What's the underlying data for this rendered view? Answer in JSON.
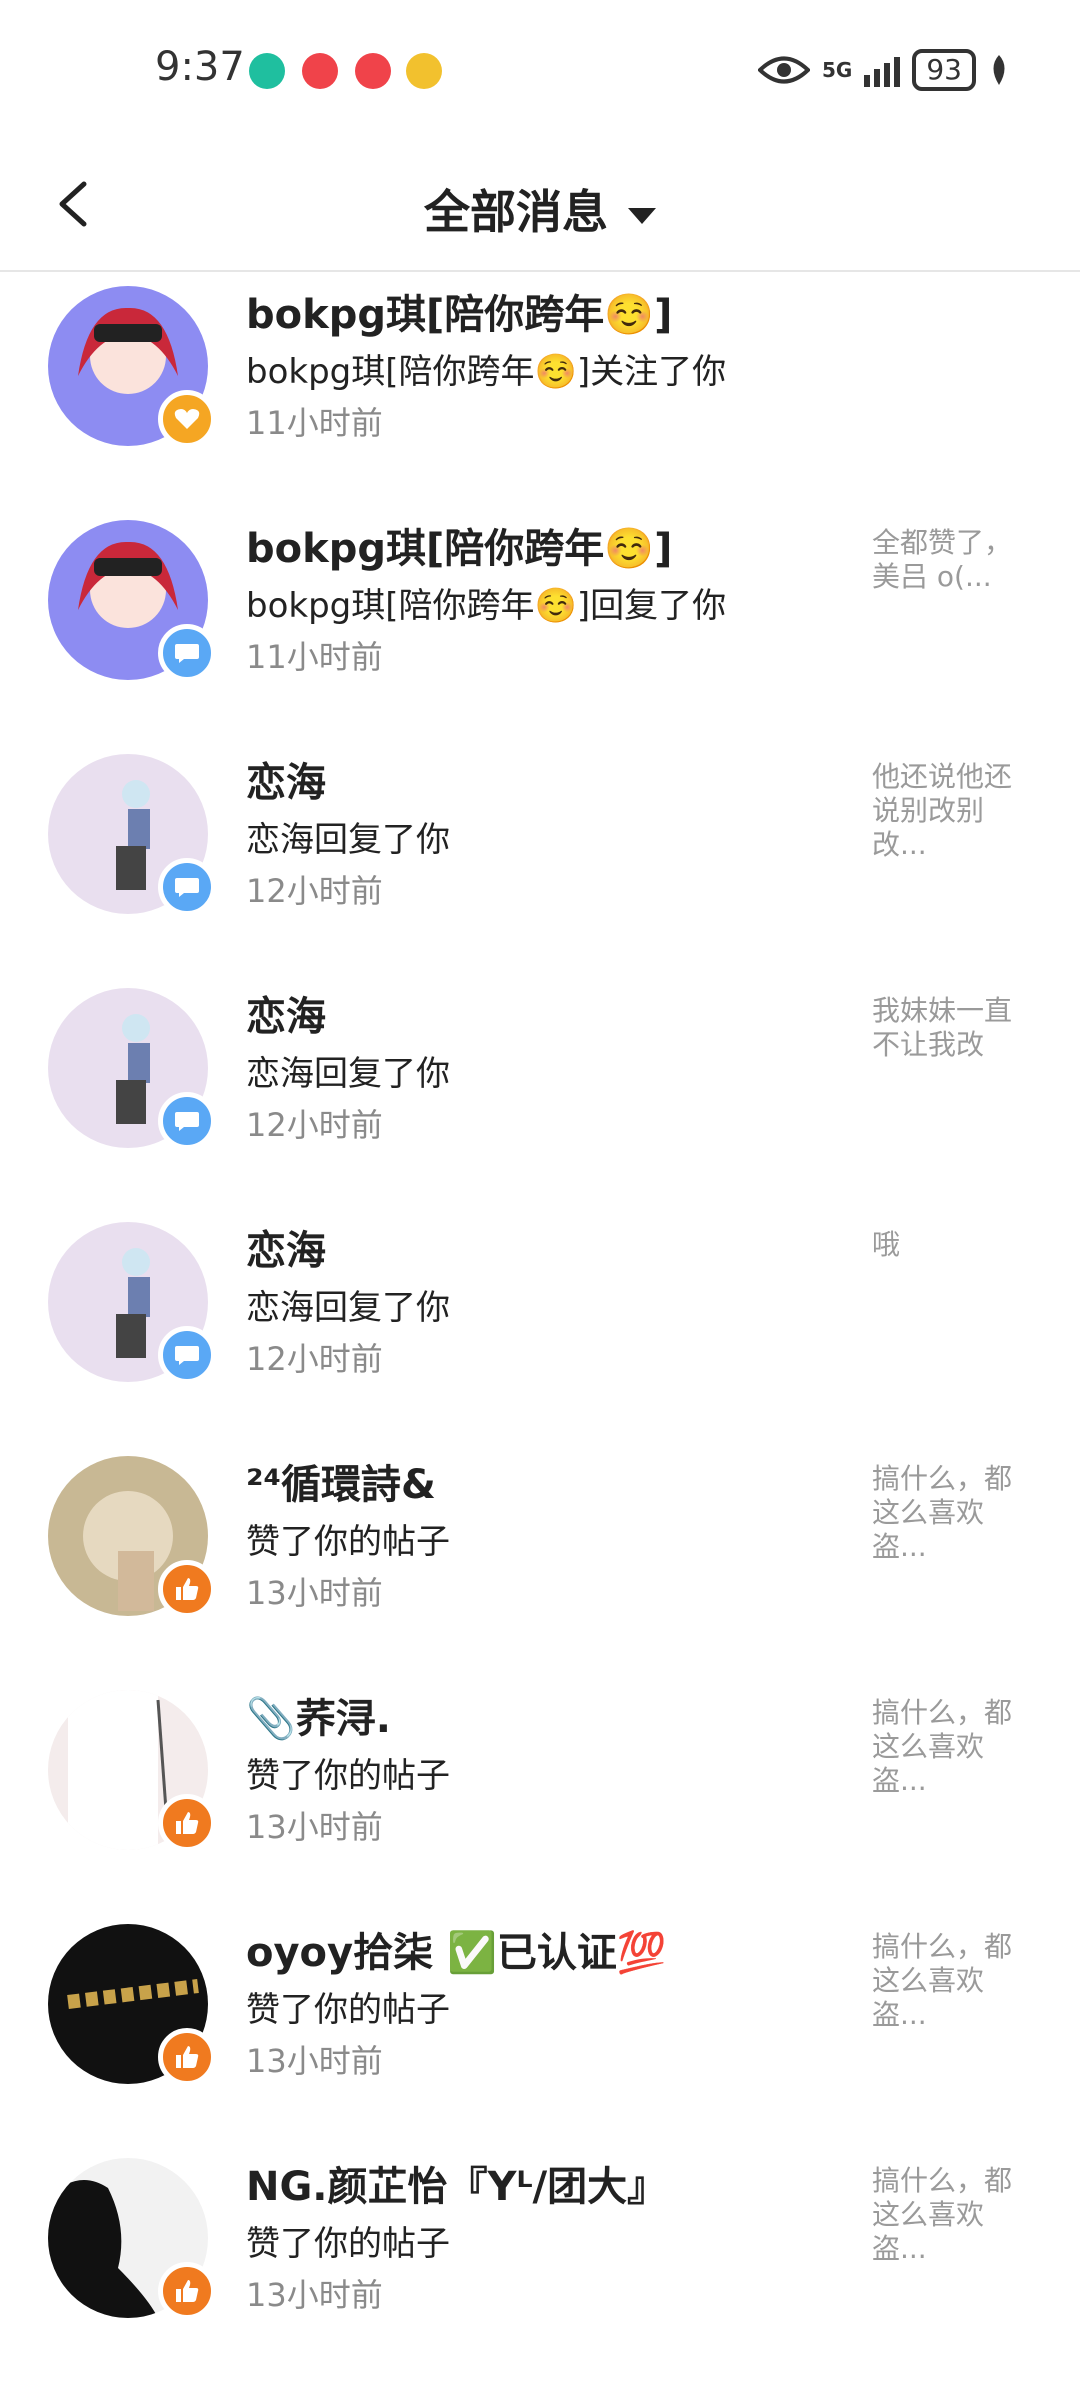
{
  "status_bar": {
    "time": "9:37",
    "network": "5G",
    "battery": "93"
  },
  "header": {
    "title": "全部消息"
  },
  "messages": [
    {
      "name": "bokpg琪[陪你跨年☺️]",
      "action": "bokpg琪[陪你跨年☺️]关注了你",
      "time": "11小时前",
      "preview": "",
      "badge": "heart-icon"
    },
    {
      "name": "bokpg琪[陪你跨年☺️]",
      "action": "bokpg琪[陪你跨年☺️]回复了你",
      "time": "11小时前",
      "preview": "全都赞了，美吕 o(...",
      "badge": "chat-icon"
    },
    {
      "name": "恋海",
      "action": "恋海回复了你",
      "time": "12小时前",
      "preview": "他还说他还说别改别改...",
      "badge": "chat-icon"
    },
    {
      "name": "恋海",
      "action": "恋海回复了你",
      "time": "12小时前",
      "preview": "我妹妹一直不让我改",
      "badge": "chat-icon"
    },
    {
      "name": "恋海",
      "action": "恋海回复了你",
      "time": "12小时前",
      "preview": "哦",
      "badge": "chat-icon"
    },
    {
      "name": "²⁴循環詩&",
      "action": "赞了你的帖子",
      "time": "13小时前",
      "preview": "搞什么，都这么喜欢盗...",
      "badge": "thumbs-up-icon"
    },
    {
      "name": "📎荞浔.",
      "action": "赞了你的帖子",
      "time": "13小时前",
      "preview": "搞什么，都这么喜欢盗...",
      "badge": "thumbs-up-icon"
    },
    {
      "name": "oyoy拾柒 ✅已认证💯",
      "action": "赞了你的帖子",
      "time": "13小时前",
      "preview": "搞什么，都这么喜欢盗...",
      "badge": "thumbs-up-icon"
    },
    {
      "name": "NG.颜芷怡『Yᴸ/团大』",
      "action": "赞了你的帖子",
      "time": "13小时前",
      "preview": "搞什么，都这么喜欢盗...",
      "badge": "thumbs-up-icon"
    }
  ]
}
